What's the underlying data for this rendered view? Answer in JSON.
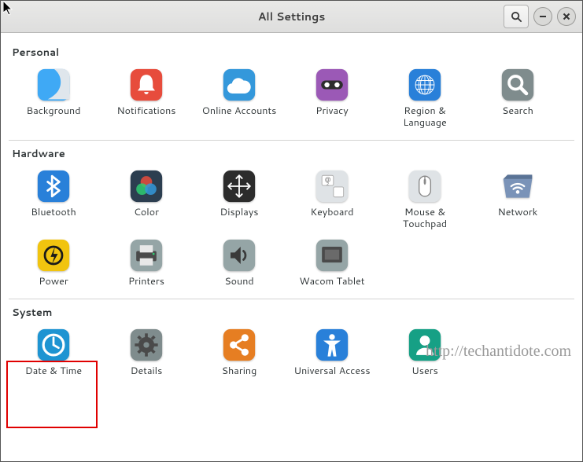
{
  "window_title": "All Settings",
  "watermark": "http://techantidote.com",
  "sections": {
    "personal": {
      "title": "Personal",
      "items": {
        "background": "Background",
        "notifications": "Notifications",
        "online_accounts": "Online Accounts",
        "privacy": "Privacy",
        "region_language": "Region & Language",
        "search": "Search"
      }
    },
    "hardware": {
      "title": "Hardware",
      "items": {
        "bluetooth": "Bluetooth",
        "color": "Color",
        "displays": "Displays",
        "keyboard": "Keyboard",
        "mouse_touchpad": "Mouse & Touchpad",
        "network": "Network",
        "power": "Power",
        "printers": "Printers",
        "sound": "Sound",
        "wacom_tablet": "Wacom Tablet"
      }
    },
    "system": {
      "title": "System",
      "items": {
        "date_time": "Date & Time",
        "details": "Details",
        "sharing": "Sharing",
        "universal_access": "Universal Access",
        "users": "Users"
      }
    }
  }
}
